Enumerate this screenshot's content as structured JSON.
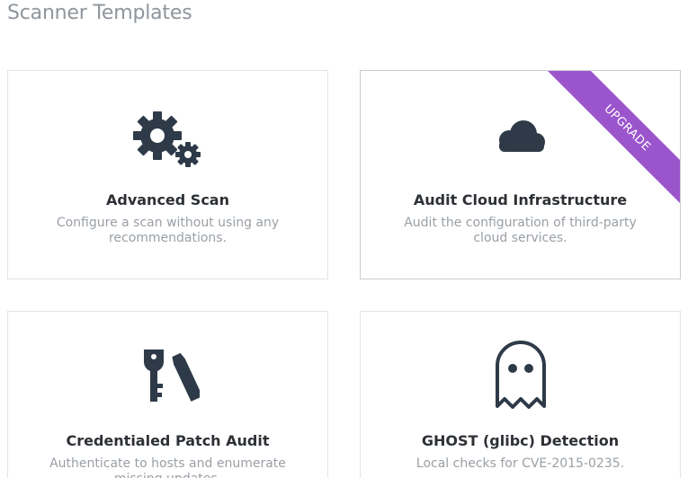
{
  "page": {
    "title": "Scanner Templates"
  },
  "colors": {
    "icon": "#2e3a48",
    "ribbon": "#9b55cc",
    "title_text": "#2d3136",
    "desc_text": "#9aa0a6"
  },
  "templates": [
    {
      "title": "Advanced Scan",
      "description": "Configure a scan without using any recommendations.",
      "icon": "gears-icon"
    },
    {
      "title": "Audit Cloud Infrastructure",
      "description": "Audit the configuration of third-party cloud services.",
      "icon": "cloud-icon",
      "badge": "UPGRADE"
    },
    {
      "title": "Credentialed Patch Audit",
      "description": "Authenticate to hosts and enumerate missing updates.",
      "icon": "key-icon"
    },
    {
      "title": "GHOST (glibc) Detection",
      "description": "Local checks for CVE-2015-0235.",
      "icon": "ghost-icon"
    }
  ]
}
